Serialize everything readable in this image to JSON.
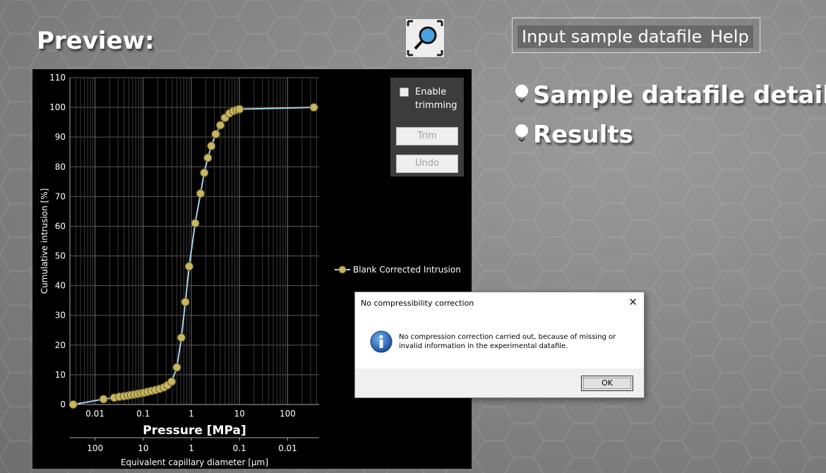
{
  "header": {
    "preview_title": "Preview:"
  },
  "menu": {
    "input_label": "Input sample datafile",
    "help_label": "Help"
  },
  "sections": [
    {
      "label": "Sample datafile details"
    },
    {
      "label": "Results"
    }
  ],
  "trim_panel": {
    "checkbox_label_line1": "Enable",
    "checkbox_label_line2": "trimming",
    "checkbox_checked": false,
    "trim_label": "Trim",
    "undo_label": "Undo"
  },
  "dialog": {
    "title": "No compressibility correction",
    "close_glyph": "✕",
    "message_line1": "No compression correction carried out, because of missing or",
    "message_line2": "invalid information in the experimental datafile.",
    "ok_label": "OK",
    "icon": "info-icon"
  },
  "colors": {
    "series": "#c8b560",
    "line": "#a9d4e8",
    "grid": "#5a5a5a",
    "accent_blue": "#2a6fc4"
  },
  "chart_data": {
    "type": "scatter",
    "x_scale": "log",
    "xlabel": "Pressure [MPa]",
    "ylabel": "Cumulative intrusion [%]",
    "secondary_xlabel": "Equivalent capillary diameter [µm]",
    "ylim": [
      0,
      110
    ],
    "xlim": [
      0.003,
      450
    ],
    "x_ticks": [
      "0.01",
      "0.1",
      "1",
      "10",
      "100"
    ],
    "y_ticks": [
      "0",
      "10",
      "20",
      "30",
      "40",
      "50",
      "60",
      "70",
      "80",
      "90",
      "100",
      "110"
    ],
    "secondary_ticks": [
      "100",
      "10",
      "1",
      "0.1",
      "0.01"
    ],
    "legend_position": "right",
    "series": [
      {
        "name": "Blank Corrected Intrusion",
        "x": [
          0.0035,
          0.015,
          0.025,
          0.032,
          0.04,
          0.048,
          0.056,
          0.066,
          0.077,
          0.09,
          0.105,
          0.125,
          0.15,
          0.18,
          0.22,
          0.27,
          0.32,
          0.39,
          0.5,
          0.62,
          0.75,
          0.9,
          1.2,
          1.55,
          1.85,
          2.2,
          2.6,
          3.2,
          4.0,
          5.0,
          6.2,
          7.5,
          8.8,
          10.0,
          350
        ],
        "y": [
          0,
          1.8,
          2.3,
          2.6,
          2.8,
          3.0,
          3.2,
          3.4,
          3.6,
          3.8,
          4.0,
          4.3,
          4.6,
          4.9,
          5.3,
          5.8,
          6.5,
          7.7,
          12.5,
          22.5,
          34.5,
          46.5,
          61,
          71,
          78,
          83,
          87,
          91,
          94,
          96.5,
          98,
          98.8,
          99.2,
          99.4,
          100
        ]
      }
    ]
  }
}
